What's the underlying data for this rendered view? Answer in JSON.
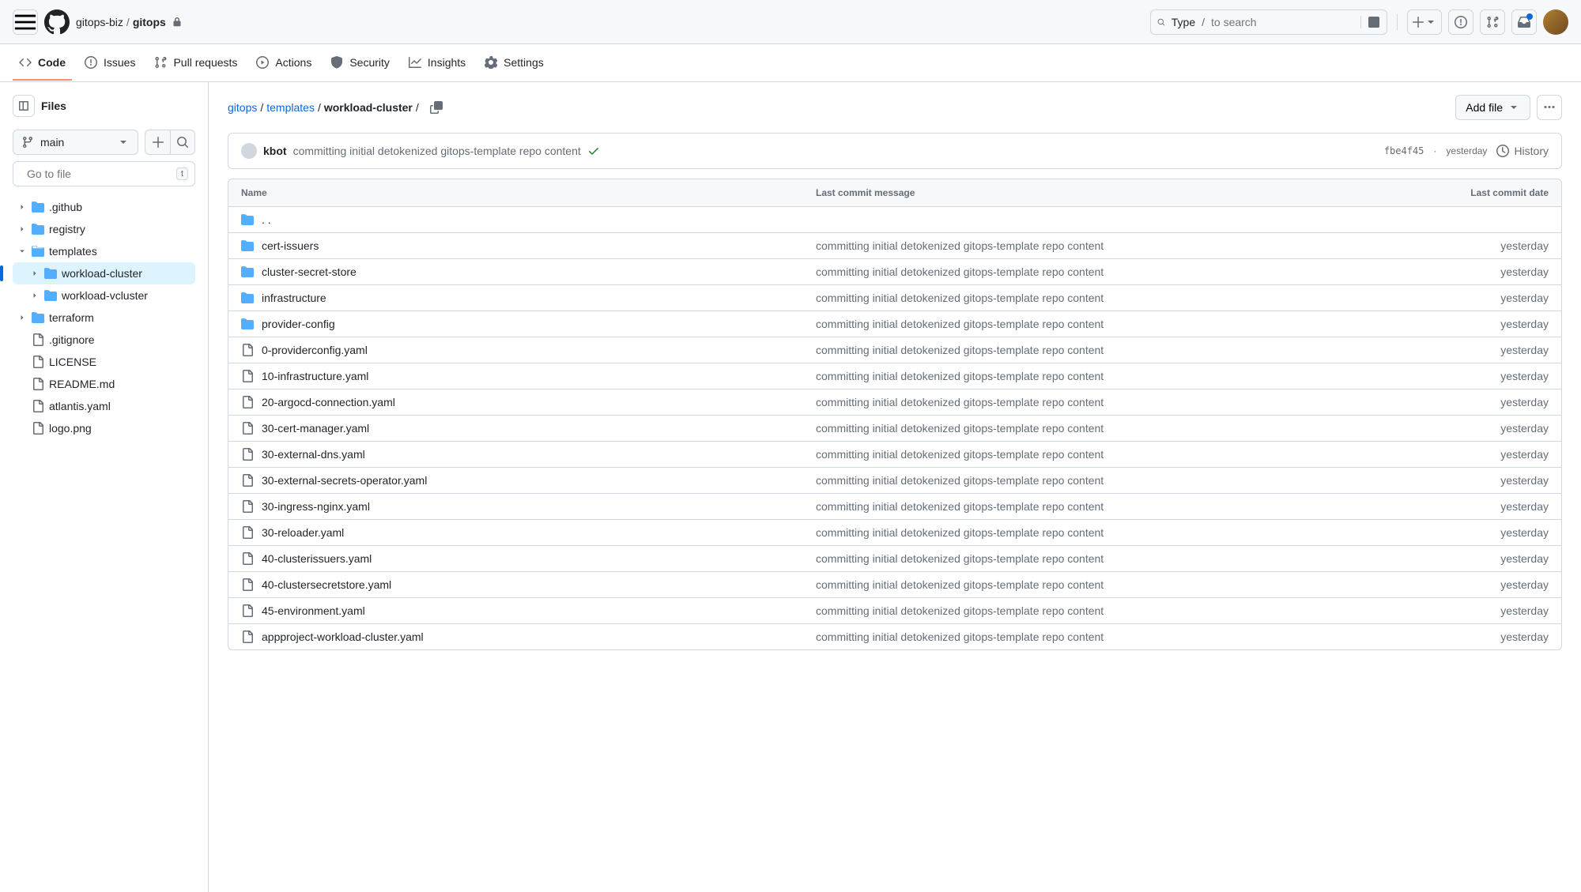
{
  "header": {
    "org": "gitops-biz",
    "repo": "gitops",
    "search_prefix": "Type",
    "search_placeholder": "to search"
  },
  "nav": {
    "code": "Code",
    "issues": "Issues",
    "pulls": "Pull requests",
    "actions": "Actions",
    "security": "Security",
    "insights": "Insights",
    "settings": "Settings"
  },
  "sidebar": {
    "title": "Files",
    "branch": "main",
    "search_placeholder": "Go to file",
    "kbd": "t",
    "tree": {
      "github": ".github",
      "registry": "registry",
      "templates": "templates",
      "workload_cluster": "workload-cluster",
      "workload_vcluster": "workload-vcluster",
      "terraform": "terraform",
      "gitignore": ".gitignore",
      "license": "LICENSE",
      "readme": "README.md",
      "atlantis": "atlantis.yaml",
      "logo": "logo.png"
    }
  },
  "breadcrumb": {
    "root": "gitops",
    "mid": "templates",
    "current": "workload-cluster"
  },
  "actions": {
    "add_file": "Add file"
  },
  "commit": {
    "author": "kbot",
    "message": "committing initial detokenized gitops-template repo content",
    "sha": "fbe4f45",
    "sep": "·",
    "time": "yesterday",
    "history": "History"
  },
  "table": {
    "col_name": "Name",
    "col_msg": "Last commit message",
    "col_date": "Last commit date",
    "parent": ". .",
    "rows": [
      {
        "type": "dir",
        "name": "cert-issuers",
        "msg": "committing initial detokenized gitops-template repo content",
        "date": "yesterday"
      },
      {
        "type": "dir",
        "name": "cluster-secret-store",
        "msg": "committing initial detokenized gitops-template repo content",
        "date": "yesterday"
      },
      {
        "type": "dir",
        "name": "infrastructure",
        "msg": "committing initial detokenized gitops-template repo content",
        "date": "yesterday"
      },
      {
        "type": "dir",
        "name": "provider-config",
        "msg": "committing initial detokenized gitops-template repo content",
        "date": "yesterday"
      },
      {
        "type": "file",
        "name": "0-providerconfig.yaml",
        "msg": "committing initial detokenized gitops-template repo content",
        "date": "yesterday"
      },
      {
        "type": "file",
        "name": "10-infrastructure.yaml",
        "msg": "committing initial detokenized gitops-template repo content",
        "date": "yesterday"
      },
      {
        "type": "file",
        "name": "20-argocd-connection.yaml",
        "msg": "committing initial detokenized gitops-template repo content",
        "date": "yesterday"
      },
      {
        "type": "file",
        "name": "30-cert-manager.yaml",
        "msg": "committing initial detokenized gitops-template repo content",
        "date": "yesterday"
      },
      {
        "type": "file",
        "name": "30-external-dns.yaml",
        "msg": "committing initial detokenized gitops-template repo content",
        "date": "yesterday"
      },
      {
        "type": "file",
        "name": "30-external-secrets-operator.yaml",
        "msg": "committing initial detokenized gitops-template repo content",
        "date": "yesterday"
      },
      {
        "type": "file",
        "name": "30-ingress-nginx.yaml",
        "msg": "committing initial detokenized gitops-template repo content",
        "date": "yesterday"
      },
      {
        "type": "file",
        "name": "30-reloader.yaml",
        "msg": "committing initial detokenized gitops-template repo content",
        "date": "yesterday"
      },
      {
        "type": "file",
        "name": "40-clusterissuers.yaml",
        "msg": "committing initial detokenized gitops-template repo content",
        "date": "yesterday"
      },
      {
        "type": "file",
        "name": "40-clustersecretstore.yaml",
        "msg": "committing initial detokenized gitops-template repo content",
        "date": "yesterday"
      },
      {
        "type": "file",
        "name": "45-environment.yaml",
        "msg": "committing initial detokenized gitops-template repo content",
        "date": "yesterday"
      },
      {
        "type": "file",
        "name": "appproject-workload-cluster.yaml",
        "msg": "committing initial detokenized gitops-template repo content",
        "date": "yesterday"
      }
    ]
  }
}
